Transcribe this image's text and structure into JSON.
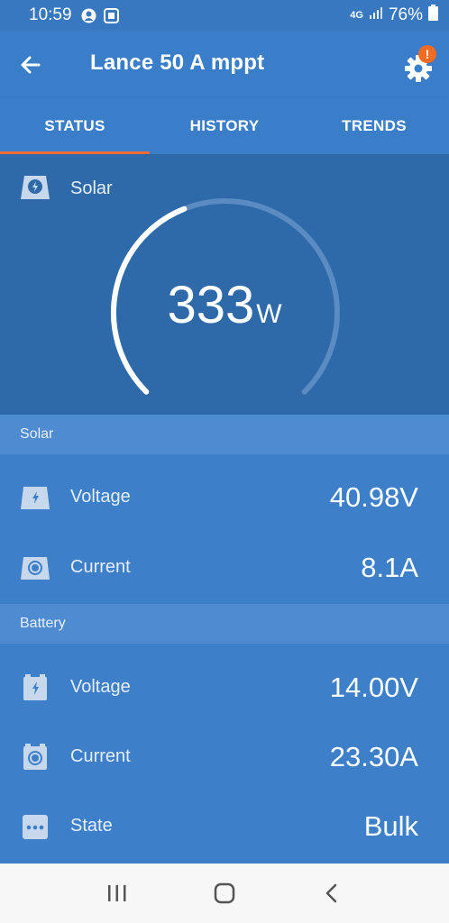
{
  "status_bar": {
    "time": "10:59",
    "network": "4G",
    "battery": "76%"
  },
  "app_bar": {
    "title": "Lance 50 A mppt",
    "notification_badge": "!"
  },
  "tabs": [
    {
      "label": "STATUS",
      "active": true
    },
    {
      "label": "HISTORY",
      "active": false
    },
    {
      "label": "TRENDS",
      "active": false
    }
  ],
  "gauge": {
    "label": "Solar",
    "value": "333",
    "unit": "W",
    "level": 0.42
  },
  "sections": {
    "solar": {
      "header": "Solar",
      "rows": [
        {
          "label": "Voltage",
          "value": "40.98V",
          "icon": "solar-voltage-icon"
        },
        {
          "label": "Current",
          "value": "8.1A",
          "icon": "solar-current-icon"
        }
      ]
    },
    "battery": {
      "header": "Battery",
      "rows": [
        {
          "label": "Voltage",
          "value": "14.00V",
          "icon": "battery-voltage-icon"
        },
        {
          "label": "Current",
          "value": "23.30A",
          "icon": "battery-current-icon"
        },
        {
          "label": "State",
          "value": "Bulk",
          "icon": "state-icon"
        }
      ]
    }
  },
  "colors": {
    "primary": "#3a7dc9",
    "panel_dark": "#2e6aa9",
    "section_header": "#4f8bd0",
    "accent": "#f06a35",
    "badge": "#f26b22"
  }
}
